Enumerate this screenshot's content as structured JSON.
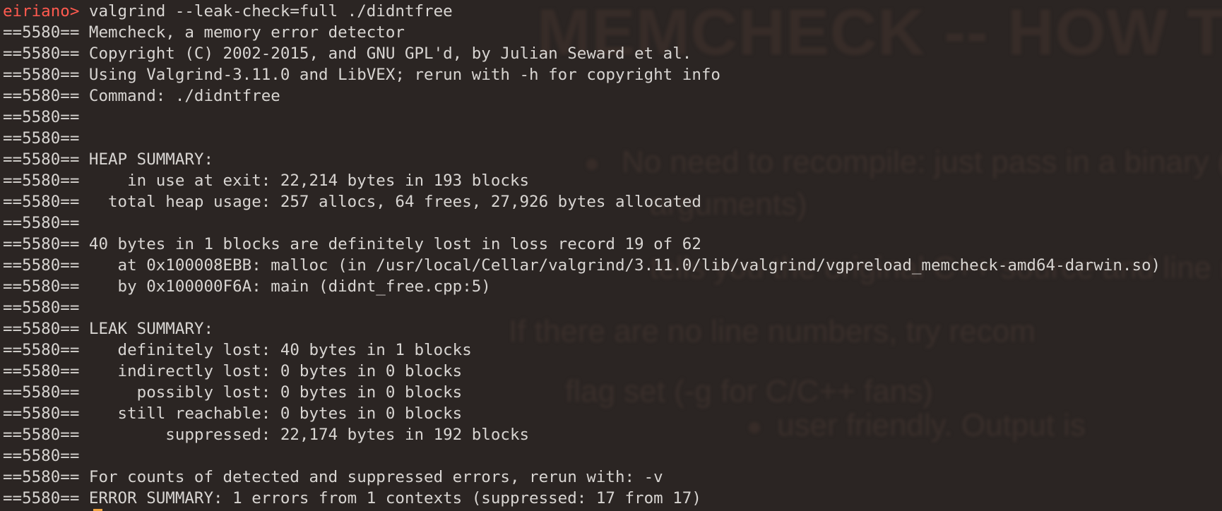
{
  "terminal": {
    "prompt": {
      "user": "eiriano>",
      "command": " valgrind --leak-check=full ./didntfree"
    },
    "output_lines": [
      "==5580== Memcheck, a memory error detector",
      "==5580== Copyright (C) 2002-2015, and GNU GPL'd, by Julian Seward et al.",
      "==5580== Using Valgrind-3.11.0 and LibVEX; rerun with -h for copyright info",
      "==5580== Command: ./didntfree",
      "==5580==",
      "==5580==",
      "==5580== HEAP SUMMARY:",
      "==5580==     in use at exit: 22,214 bytes in 193 blocks",
      "==5580==   total heap usage: 257 allocs, 64 frees, 27,926 bytes allocated",
      "==5580==",
      "==5580== 40 bytes in 1 blocks are definitely lost in loss record 19 of 62",
      "==5580==    at 0x100008EBB: malloc (in /usr/local/Cellar/valgrind/3.11.0/lib/valgrind/vgpreload_memcheck-amd64-darwin.so)",
      "==5580==    by 0x100000F6A: main (didnt_free.cpp:5)",
      "==5580==",
      "==5580== LEAK SUMMARY:",
      "==5580==    definitely lost: 40 bytes in 1 blocks",
      "==5580==    indirectly lost: 0 bytes in 0 blocks",
      "==5580==      possibly lost: 0 bytes in 0 blocks",
      "==5580==    still reachable: 0 bytes in 0 blocks",
      "==5580==         suppressed: 22,174 bytes in 192 blocks",
      "==5580==",
      "==5580== For counts of detected and suppressed errors, rerun with: -v",
      "==5580== ERROR SUMMARY: 1 errors from 1 contexts (suppressed: 17 from 17)"
    ],
    "colors": {
      "background": "#2b2523",
      "text": "#d8d5d2",
      "prompt_user": "#ff5a4f",
      "cursor": "#f0a340"
    }
  }
}
